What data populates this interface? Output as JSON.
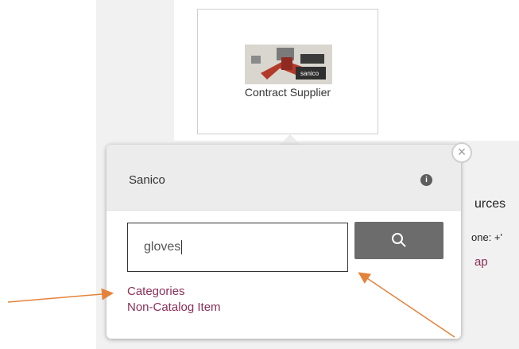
{
  "supplier_card": {
    "label": "Contract Supplier",
    "logo_text": "sanico"
  },
  "background": {
    "text_fragments": [
      "urces",
      "one: +'",
      "ap"
    ]
  },
  "popover": {
    "title": "Sanico",
    "info_icon_glyph": "i",
    "search": {
      "value": "gloves",
      "button_icon": "search-icon"
    },
    "links": [
      "Categories",
      "Non-Catalog Item"
    ],
    "close_glyph": "×"
  },
  "colors": {
    "link": "#8a2f57",
    "annotation_arrow": "#e5823a",
    "search_button": "#6c6c6c",
    "header": "#ececec"
  }
}
